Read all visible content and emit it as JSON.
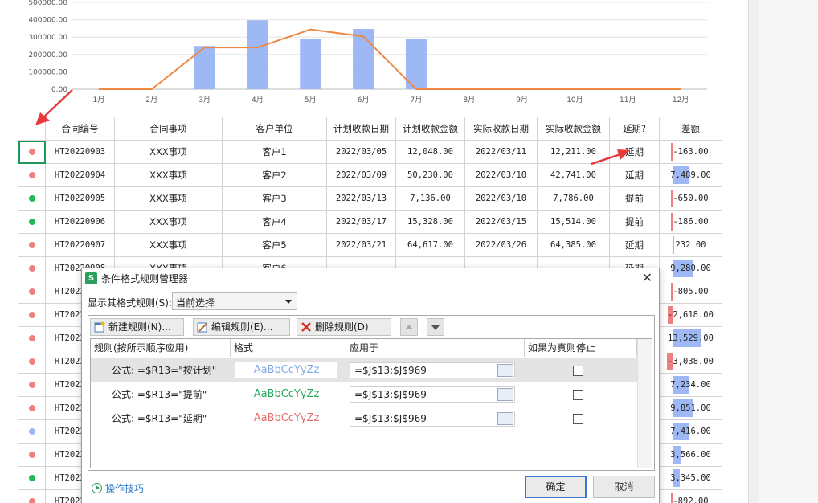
{
  "chart_data": {
    "type": "bar",
    "categories": [
      "1月",
      "2月",
      "3月",
      "4月",
      "5月",
      "6月",
      "7月",
      "8月",
      "9月",
      "10月",
      "11月",
      "12月"
    ],
    "y_ticks": [
      "0.00",
      "100000.00",
      "200000.00",
      "300000.00",
      "400000.00",
      "500000.00"
    ],
    "ylim": [
      0,
      500000
    ],
    "series": [
      {
        "type": "bar",
        "values": [
          0,
          0,
          249000,
          397000,
          290000,
          347000,
          287000,
          0,
          0,
          0,
          0,
          0
        ],
        "color": "#9db8f5"
      },
      {
        "type": "line",
        "values": [
          0,
          0,
          240000,
          240000,
          344000,
          304000,
          0,
          0,
          0,
          0,
          0,
          0
        ],
        "color": "#ee8844"
      }
    ]
  },
  "table": {
    "headers": [
      "",
      "合同编号",
      "合同事项",
      "客户单位",
      "计划收款日期",
      "计划收款金额",
      "实际收款日期",
      "实际收款金额",
      "延期?",
      "差额"
    ],
    "rows": [
      {
        "dot": "#f07f7f",
        "id": "HT20220903",
        "item": "XXX事项",
        "client": "客户1",
        "plan_date": "2022/03/05",
        "plan_amt": "12,048.00",
        "act_date": "2022/03/11",
        "act_amt": "12,211.00",
        "status": "延期",
        "diff": "-163.00",
        "bar": -0.05
      },
      {
        "dot": "#f07f7f",
        "id": "HT20220904",
        "item": "XXX事项",
        "client": "客户2",
        "plan_date": "2022/03/09",
        "plan_amt": "50,230.00",
        "act_date": "2022/03/10",
        "act_amt": "42,741.00",
        "status": "延期",
        "diff": "7,489.00",
        "bar": 0.55
      },
      {
        "dot": "#22b85a",
        "id": "HT20220905",
        "item": "XXX事项",
        "client": "客户3",
        "plan_date": "2022/03/13",
        "plan_amt": "7,136.00",
        "act_date": "2022/03/10",
        "act_amt": "7,786.00",
        "status": "提前",
        "diff": "-650.00",
        "bar": -0.1
      },
      {
        "dot": "#22b85a",
        "id": "HT20220906",
        "item": "XXX事项",
        "client": "客户4",
        "plan_date": "2022/03/17",
        "plan_amt": "15,328.00",
        "act_date": "2022/03/15",
        "act_amt": "15,514.00",
        "status": "提前",
        "diff": "-186.00",
        "bar": -0.05
      },
      {
        "dot": "#f07f7f",
        "id": "HT20220907",
        "item": "XXX事项",
        "client": "客户5",
        "plan_date": "2022/03/21",
        "plan_amt": "64,617.00",
        "act_date": "2022/03/26",
        "act_amt": "64,385.00",
        "status": "延期",
        "diff": "232.00",
        "bar": 0.02
      },
      {
        "dot": "#f07f7f",
        "id": "HT20220908",
        "item": "XXX事项",
        "client": "客户6",
        "plan_date": "",
        "plan_amt": "",
        "act_date": "",
        "act_amt": "",
        "status": "延期",
        "diff": "9,280.00",
        "bar": 0.7
      },
      {
        "dot": "#f07f7f",
        "id": "HT20220909",
        "item": "",
        "client": "",
        "plan_date": "",
        "plan_amt": "",
        "act_date": "",
        "act_amt": "",
        "status": "",
        "diff": "-805.00",
        "bar": -0.1
      },
      {
        "dot": "#f07f7f",
        "id": "HT20220910",
        "item": "",
        "client": "",
        "plan_date": "",
        "plan_amt": "",
        "act_date": "",
        "act_amt": "",
        "status": "",
        "diff": "-2,618.00",
        "bar": -0.3
      },
      {
        "dot": "#f07f7f",
        "id": "HT20220911",
        "item": "",
        "client": "",
        "plan_date": "",
        "plan_amt": "",
        "act_date": "",
        "act_amt": "",
        "status": "",
        "diff": "13,529.00",
        "bar": 1.0
      },
      {
        "dot": "#f07f7f",
        "id": "HT20220912",
        "item": "",
        "client": "",
        "plan_date": "",
        "plan_amt": "",
        "act_date": "",
        "act_amt": "",
        "status": "",
        "diff": "-3,038.00",
        "bar": -0.35
      },
      {
        "dot": "#f07f7f",
        "id": "HT20220913",
        "item": "",
        "client": "",
        "plan_date": "",
        "plan_amt": "",
        "act_date": "",
        "act_amt": "",
        "status": "",
        "diff": "7,234.00",
        "bar": 0.55
      },
      {
        "dot": "#f07f7f",
        "id": "HT20220914",
        "item": "",
        "client": "",
        "plan_date": "",
        "plan_amt": "",
        "act_date": "",
        "act_amt": "",
        "status": "",
        "diff": "9,851.00",
        "bar": 0.72
      },
      {
        "dot": "#9db8f5",
        "id": "HT20220915",
        "item": "",
        "client": "",
        "plan_date": "",
        "plan_amt": "",
        "act_date": "",
        "act_amt": "",
        "status": "",
        "diff": "7,416.00",
        "bar": 0.55
      },
      {
        "dot": "#f07f7f",
        "id": "HT20220916",
        "item": "",
        "client": "",
        "plan_date": "",
        "plan_amt": "",
        "act_date": "",
        "act_amt": "",
        "status": "",
        "diff": "3,566.00",
        "bar": 0.27
      },
      {
        "dot": "#22b85a",
        "id": "HT20220917",
        "item": "",
        "client": "",
        "plan_date": "",
        "plan_amt": "",
        "act_date": "",
        "act_amt": "",
        "status": "",
        "diff": "3,345.00",
        "bar": 0.25
      },
      {
        "dot": "#f07f7f",
        "id": "HT20220918",
        "item": "",
        "client": "",
        "plan_date": "",
        "plan_amt": "",
        "act_date": "",
        "act_amt": "",
        "status": "",
        "diff": "-892.00",
        "bar": -0.1
      }
    ]
  },
  "dialog": {
    "title": "条件格式规则管理器",
    "show_rules_label": "显示其格式规则(S):",
    "show_rules_value": "当前选择",
    "new_rule": "新建规则(N)...",
    "edit_rule": "编辑规则(E)...",
    "delete_rule": "删除规则(D)",
    "col_rule": "规则(按所示顺序应用)",
    "col_format": "格式",
    "col_apply": "应用于",
    "col_stop": "如果为真则停止",
    "rules": [
      {
        "rule": "公式: =$R13=\"按计划\"",
        "sample": "AaBbCcYyZz",
        "color": "#7fa8e8",
        "apply": "=$J$13:$J$969"
      },
      {
        "rule": "公式: =$R13=\"提前\"",
        "sample": "AaBbCcYyZz",
        "color": "#22a85a",
        "apply": "=$J$13:$J$969"
      },
      {
        "rule": "公式: =$R13=\"延期\"",
        "sample": "AaBbCcYyZz",
        "color": "#e86a6a",
        "apply": "=$J$13:$J$969"
      }
    ],
    "tips": "操作技巧",
    "ok": "确定",
    "cancel": "取消"
  },
  "colors": {
    "accent": "#3a78d0",
    "delay": "#f07f7f",
    "early": "#22b85a",
    "bar": "#9db8f5",
    "neg_bar": "#f07f7f",
    "arrow": "#e83a3a"
  }
}
